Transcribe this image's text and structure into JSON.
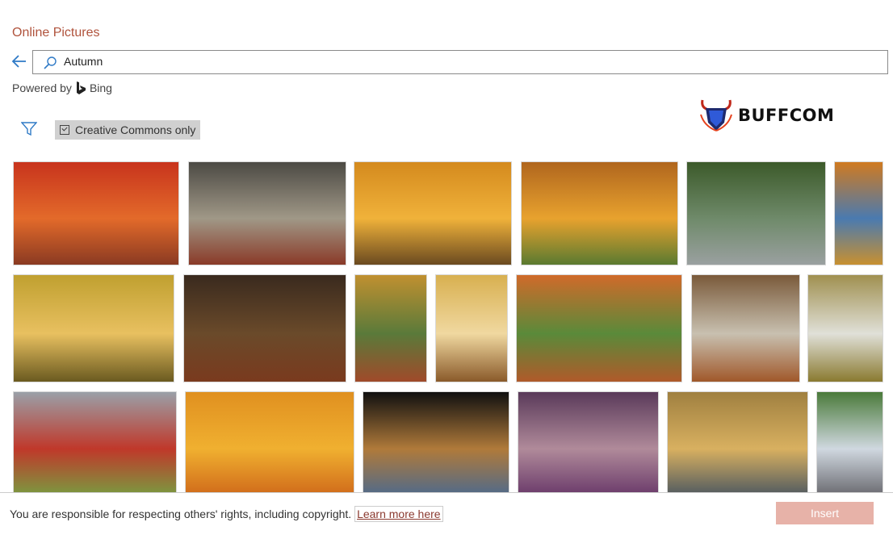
{
  "dialog": {
    "title": "Online Pictures"
  },
  "search": {
    "value": "Autumn",
    "placeholder": "Search Bing"
  },
  "powered": {
    "prefix": "Powered by",
    "brand": "Bing"
  },
  "filter": {
    "creative_commons_label": "Creative Commons only",
    "checked": true
  },
  "watermark": {
    "text": "BUFFCOM"
  },
  "colors": {
    "title": "#b0533c",
    "accent": "#2f7ac6",
    "insert_disabled": "#e7b2a8"
  },
  "thumbnails": [
    {
      "c": [
        "#c8341d",
        "#e36a2a",
        "#8a3a22"
      ]
    },
    {
      "c": [
        "#4c4a44",
        "#a09887",
        "#8a3a28"
      ]
    },
    {
      "c": [
        "#d48a1e",
        "#f0b23a",
        "#6a4a20"
      ]
    },
    {
      "c": [
        "#b0661e",
        "#e8a22e",
        "#5a7a30"
      ]
    },
    {
      "c": [
        "#3c5a2a",
        "#6f8a6a",
        "#9aa0a0"
      ]
    },
    {
      "c": [
        "#d07a20",
        "#4a7ab0",
        "#c89030"
      ]
    },
    {
      "c": [
        "#c0a030",
        "#e8c060",
        "#6a5a20"
      ]
    },
    {
      "c": [
        "#3a2a1e",
        "#6a4a2a",
        "#7a3a1e"
      ]
    },
    {
      "c": [
        "#c09030",
        "#5a7a3a",
        "#a04a2a"
      ]
    },
    {
      "c": [
        "#d8b050",
        "#f0d8a0",
        "#8a5a2a"
      ]
    },
    {
      "c": [
        "#d06a2a",
        "#5a8a3a",
        "#b05a2a"
      ]
    },
    {
      "c": [
        "#7a5a3a",
        "#c8c0b0",
        "#a0582a"
      ]
    },
    {
      "c": [
        "#a09050",
        "#e0e0d8",
        "#8a7a30"
      ]
    },
    {
      "c": [
        "#9aa0a8",
        "#c0382a",
        "#7a9a40"
      ]
    },
    {
      "c": [
        "#e09020",
        "#f0b030",
        "#d06a1a"
      ]
    },
    {
      "c": [
        "#101010",
        "#b07a3a",
        "#506a8a"
      ]
    },
    {
      "c": [
        "#5a3a5a",
        "#b08a9a",
        "#6a3a6a"
      ]
    },
    {
      "c": [
        "#a08040",
        "#d8b060",
        "#505a60"
      ]
    },
    {
      "c": [
        "#4a7a3a",
        "#d0d8e0",
        "#6a6a70"
      ]
    }
  ],
  "footer": {
    "notice": "You are responsible for respecting others' rights, including copyright.",
    "learn_more": "Learn more here",
    "insert_label": "Insert"
  }
}
